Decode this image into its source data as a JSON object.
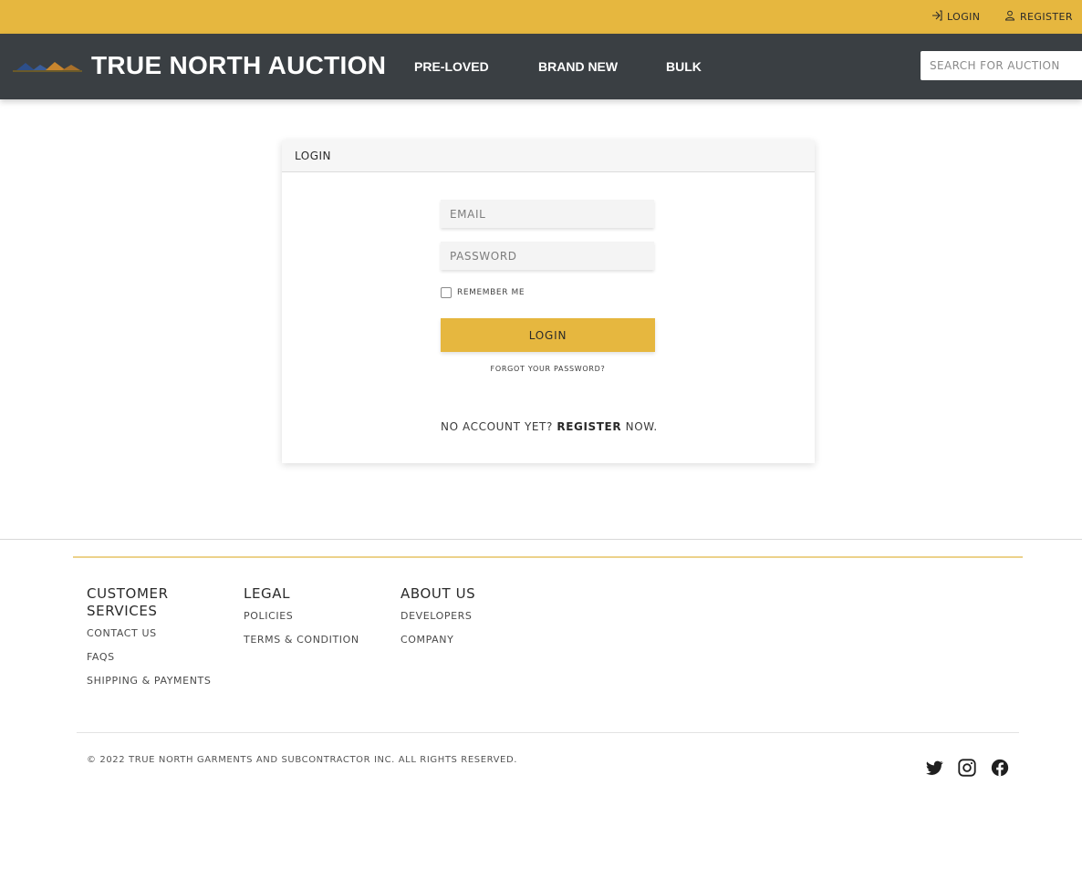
{
  "topbar": {
    "login_label": "LOGIN",
    "register_label": "REGISTER",
    "login_icon": "login-arrow-icon",
    "register_icon": "user-icon",
    "background": "#e6b73f"
  },
  "header": {
    "brand": "TRUE NORTH AUCTION",
    "logo_icon": "true-north-logo",
    "nav": [
      "PRE-LOVED",
      "BRAND NEW",
      "BULK"
    ],
    "search_placeholder": "SEARCH FOR AUCTION",
    "background": "#3a3f43"
  },
  "login_card": {
    "title": "LOGIN",
    "email_placeholder": "EMAIL",
    "password_placeholder": "PASSWORD",
    "remember_label": "REMEMBER ME",
    "remember_checked": false,
    "submit_label": "LOGIN",
    "forgot_label": "FORGOT YOUR PASSWORD?",
    "no_account_prefix": "NO ACCOUNT YET?",
    "register_link": "REGISTER",
    "no_account_suffix": "NOW."
  },
  "footer": {
    "columns": [
      {
        "heading": "CUSTOMER SERVICES",
        "links": [
          "CONTACT US",
          "FAQS",
          "SHIPPING & PAYMENTS"
        ]
      },
      {
        "heading": "LEGAL",
        "links": [
          "POLICIES",
          "TERMS & CONDITION"
        ]
      },
      {
        "heading": "ABOUT US",
        "links": [
          "DEVELOPERS",
          "COMPANY"
        ]
      }
    ],
    "copyright": "© 2022 TRUE NORTH GARMENTS AND SUBCONTRACTOR INC. ALL RIGHTS RESERVED.",
    "social_icons": [
      "twitter-icon",
      "instagram-icon",
      "facebook-icon"
    ]
  }
}
